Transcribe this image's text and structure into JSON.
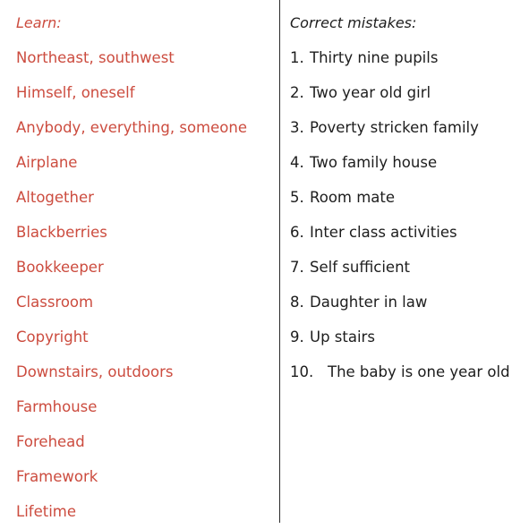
{
  "colors": {
    "learn_red": "#cc4c3f",
    "text_black": "#1d1d1d",
    "divider": "#2b2b2b",
    "background": "#ffffff"
  },
  "learn_column": {
    "heading": "Learn:",
    "items": [
      "Northeast, southwest",
      "Himself, oneself",
      "Anybody, everything, someone",
      "Airplane",
      "Altogether",
      "Blackberries",
      "Bookkeeper",
      "Classroom",
      "Copyright",
      "Downstairs, outdoors",
      "Farmhouse",
      "Forehead",
      "Framework",
      "Lifetime"
    ]
  },
  "mistakes_column": {
    "heading": "Correct mistakes:",
    "items": [
      {
        "number": "1.",
        "text": "Thirty nine pupils"
      },
      {
        "number": "2.",
        "text": "Two year old girl"
      },
      {
        "number": "3.",
        "text": "Poverty stricken family"
      },
      {
        "number": "4.",
        "text": "Two family house"
      },
      {
        "number": "5.",
        "text": "Room mate"
      },
      {
        "number": "6.",
        "text": "Inter class activities"
      },
      {
        "number": "7.",
        "text": "Self sufficient"
      },
      {
        "number": "8.",
        "text": "Daughter in law"
      },
      {
        "number": "9.",
        "text": "Up stairs"
      },
      {
        "number": "10.",
        "text": "The baby is one year old"
      }
    ]
  }
}
